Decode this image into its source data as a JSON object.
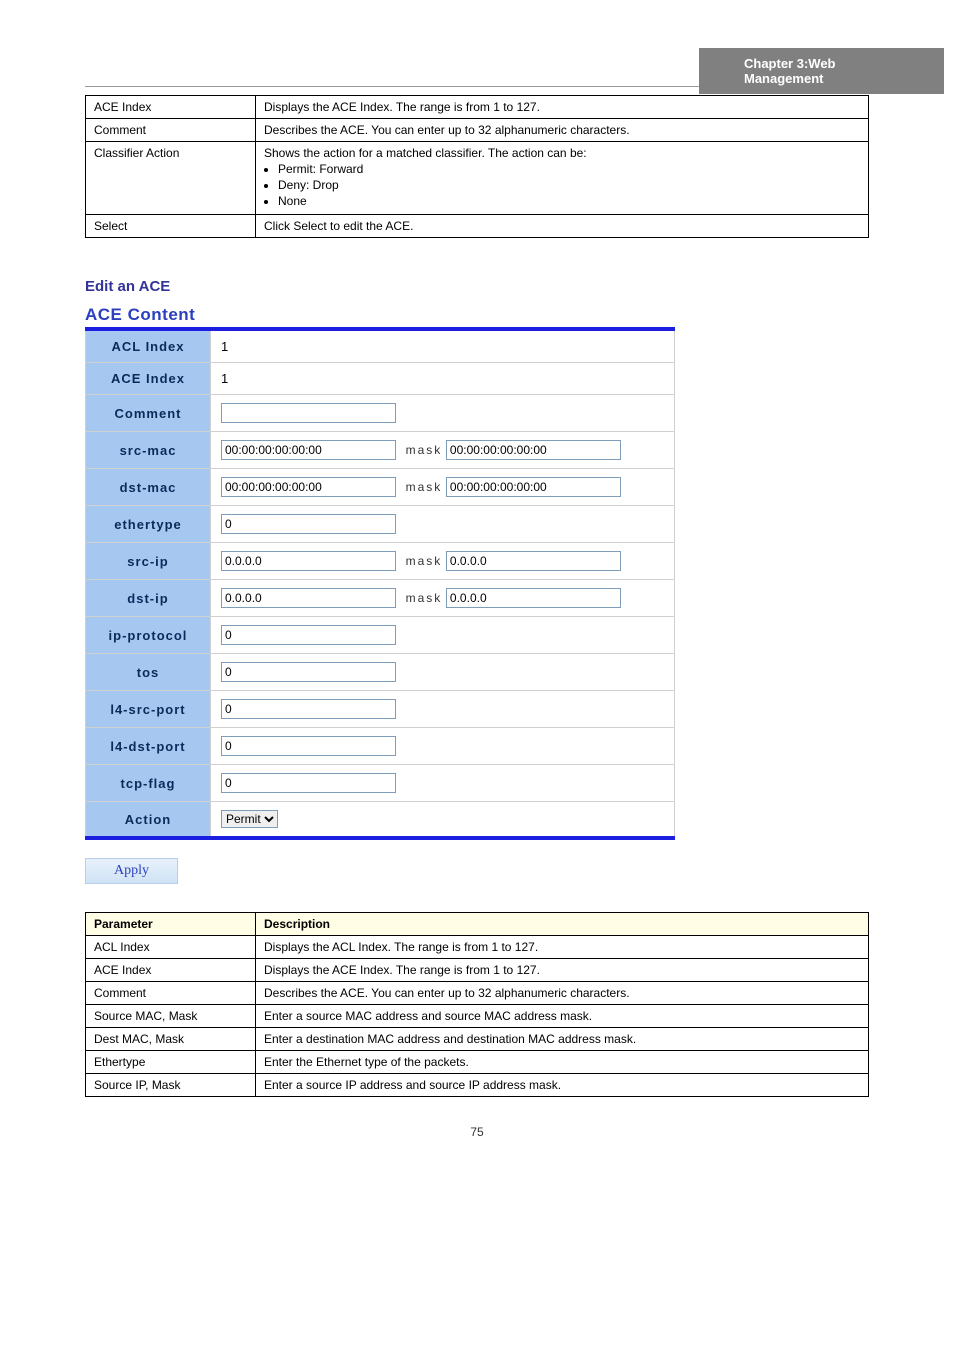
{
  "chapter": "Chapter 3:Web Management",
  "table1": {
    "rows": [
      {
        "param": "ACE Index",
        "desc": "Displays the ACE Index. The range is from 1 to 127."
      },
      {
        "param": "Comment",
        "desc": "Describes the ACE. You can enter up to 32 alphanumeric characters."
      },
      {
        "param": "Classifier Action",
        "desc_intro": "Shows the action for a matched classifier. The action can be:",
        "bullets": [
          "Permit: Forward",
          "Deny: Drop",
          "None"
        ]
      },
      {
        "param": "Select",
        "desc": "Click Select to edit the ACE."
      }
    ]
  },
  "subheading": "Edit an ACE",
  "form": {
    "title": "ACE Content",
    "acl_index_label": "ACL Index",
    "acl_index_value": "1",
    "ace_index_label": "ACE Index",
    "ace_index_value": "1",
    "comment_label": "Comment",
    "comment_value": "",
    "src_mac_label": "src-mac",
    "src_mac_value": "00:00:00:00:00:00",
    "src_mac_mask": "00:00:00:00:00:00",
    "dst_mac_label": "dst-mac",
    "dst_mac_value": "00:00:00:00:00:00",
    "dst_mac_mask": "00:00:00:00:00:00",
    "ethertype_label": "ethertype",
    "ethertype_value": "0",
    "src_ip_label": "src-ip",
    "src_ip_value": "0.0.0.0",
    "src_ip_mask": "0.0.0.0",
    "dst_ip_label": "dst-ip",
    "dst_ip_value": "0.0.0.0",
    "dst_ip_mask": "0.0.0.0",
    "ip_protocol_label": "ip-protocol",
    "ip_protocol_value": "0",
    "tos_label": "tos",
    "tos_value": "0",
    "l4_src_port_label": "l4-src-port",
    "l4_src_port_value": "0",
    "l4_dst_port_label": "l4-dst-port",
    "l4_dst_port_value": "0",
    "tcp_flag_label": "tcp-flag",
    "tcp_flag_value": "0",
    "action_label": "Action",
    "action_value": "Permit",
    "mask_text": "mask",
    "apply": "Apply"
  },
  "table2": {
    "head_param": "Parameter",
    "head_desc": "Description",
    "rows": [
      {
        "param": "ACL Index",
        "desc": "Displays the ACL Index. The range is from 1 to 127."
      },
      {
        "param": "ACE Index",
        "desc": "Displays the ACE Index. The range is from 1 to 127."
      },
      {
        "param": "Comment",
        "desc": "Describes the ACE. You can enter up to 32 alphanumeric characters."
      },
      {
        "param": "Source MAC, Mask",
        "desc": "Enter a source MAC address and source MAC address mask."
      },
      {
        "param": "Dest MAC, Mask",
        "desc": "Enter a destination MAC address and destination MAC address mask."
      },
      {
        "param": "Ethertype",
        "desc": "Enter the Ethernet type of the packets."
      },
      {
        "param": "Source IP, Mask",
        "desc": "Enter a source IP address and source IP address mask."
      }
    ]
  },
  "footer": "75"
}
